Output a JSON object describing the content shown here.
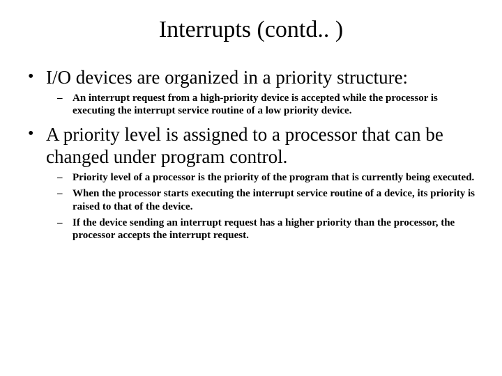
{
  "title": "Interrupts (contd.. )",
  "bullets": [
    {
      "text": "I/O devices are organized in a priority structure:",
      "sub": [
        "An interrupt request from a high-priority device is accepted while the processor is executing the interrupt service routine of a low priority device."
      ]
    },
    {
      "text": "A priority level is assigned to a processor that can be changed under program control.",
      "sub": [
        "Priority level of a processor is the priority of the program that is currently being executed.",
        "When the processor starts executing the interrupt service routine of a device, its priority is raised to that of the device.",
        "If the device sending an interrupt request has a higher priority than the processor, the processor accepts the interrupt request."
      ]
    }
  ]
}
